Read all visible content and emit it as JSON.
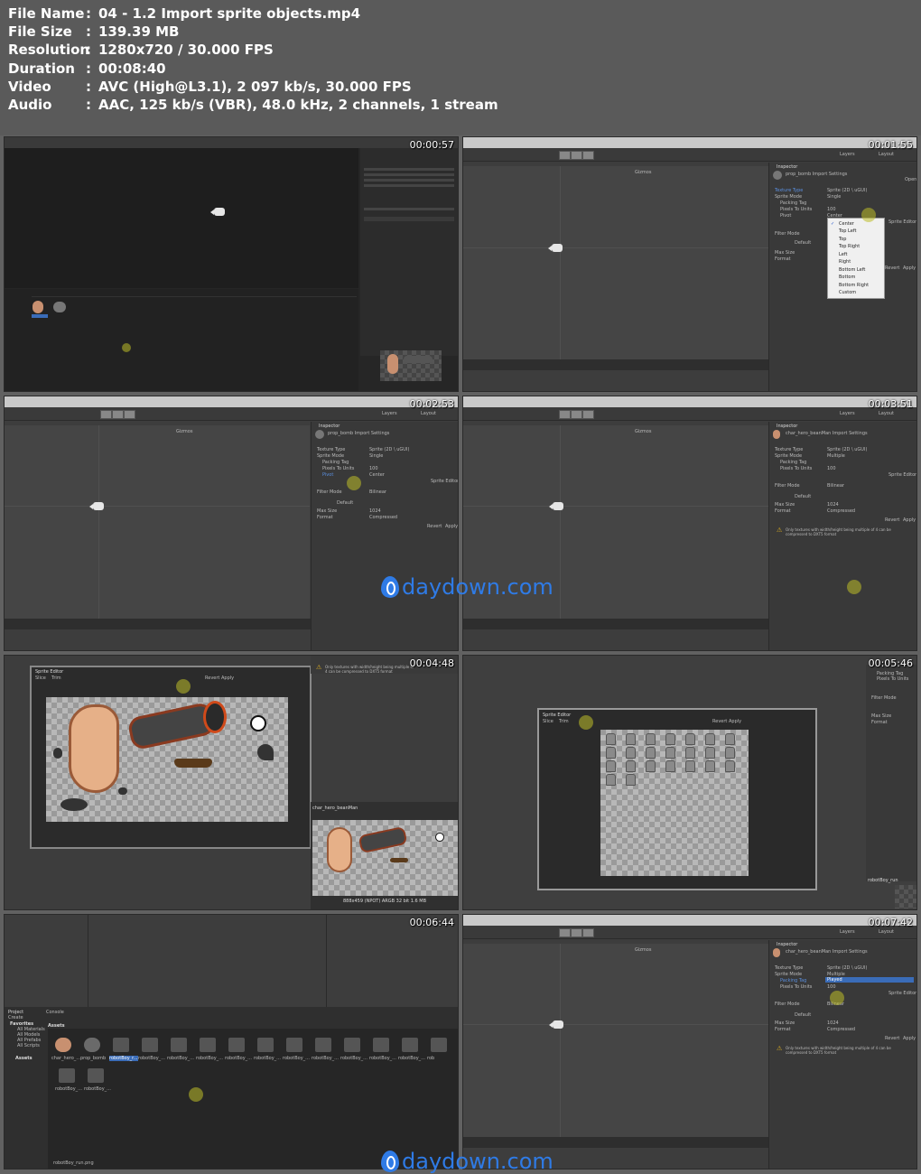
{
  "file_info": [
    {
      "key": "File Name",
      "value": "04 - 1.2 Import sprite objects.mp4"
    },
    {
      "key": "File Size",
      "value": "139.39 MB"
    },
    {
      "key": "Resolution",
      "value": "1280x720 / 30.000 FPS"
    },
    {
      "key": "Duration",
      "value": "00:08:40"
    },
    {
      "key": "Video",
      "value": "AVC (High@L3.1), 2 097 kb/s, 30.000 FPS"
    },
    {
      "key": "Audio",
      "value": "AAC, 125 kb/s (VBR), 48.0 kHz, 2 channels, 1 stream"
    }
  ],
  "separator": ":",
  "thumbnails": [
    {
      "timestamp": "00:00:57"
    },
    {
      "timestamp": "00:01:55"
    },
    {
      "timestamp": "00:02:53"
    },
    {
      "timestamp": "00:03:51"
    },
    {
      "timestamp": "00:04:48"
    },
    {
      "timestamp": "00:05:46"
    },
    {
      "timestamp": "00:06:44"
    },
    {
      "timestamp": "00:07:42"
    }
  ],
  "inspector": {
    "header": "Inspector",
    "prop_bomb_title": "prop_bomb Import Settings",
    "bean_title": "char_hero_beanMan Import Settings",
    "open": "Open",
    "texture_type": "Texture Type",
    "texture_type_value": "Sprite (2D \\ uGUI)",
    "sprite_mode": "Sprite Mode",
    "single": "Single",
    "multiple": "Multiple",
    "packing_tag": "Packing Tag",
    "pixels_to_units": "Pixels To Units",
    "ptu_value": "100",
    "pivot": "Pivot",
    "pivot_value": "Center",
    "sprite_editor": "Sprite Editor",
    "filter_mode": "Filter Mode",
    "filter_value": "Bilinear",
    "default": "Default",
    "max_size": "Max Size",
    "max_size_value": "1024",
    "format": "Format",
    "format_value": "Compressed",
    "revert": "Revert",
    "apply": "Apply",
    "warning": "Only textures with width/height being multiple of 4 can be compressed to DXT5 format",
    "played": "Played"
  },
  "pivot_options": [
    "Center",
    "Top Left",
    "Top",
    "Top Right",
    "Left",
    "Right",
    "Bottom Left",
    "Bottom",
    "Bottom Right",
    "Custom"
  ],
  "toolbar": {
    "layers": "Layers",
    "layout": "Layout",
    "gizmos": "Gizmos"
  },
  "sprite_editor": {
    "title": "Sprite Editor",
    "slice": "Slice",
    "trim": "Trim",
    "revert": "Revert",
    "apply": "Apply"
  },
  "preview": {
    "asset_name": "char_hero_beanMan",
    "asset_name2": "robotBoy_run",
    "info": "888x459 (NPOT)  ARGB 32 bit  1.6 MB"
  },
  "project": {
    "tab_project": "Project",
    "tab_console": "Console",
    "create": "Create",
    "favorites": "Favorites",
    "all_materials": "All Materials",
    "all_models": "All Models",
    "all_prefabs": "All Prefabs",
    "all_scripts": "All Scripts",
    "assets": "Assets",
    "asset_names": [
      "char_hero_...",
      "prop_bomb",
      "robotBoy_r...",
      "robotBoy_...",
      "robotBoy_...",
      "robotBoy_...",
      "robotBoy_...",
      "robotBoy_...",
      "robotBoy_...",
      "robotBoy_...",
      "robotBoy_...",
      "robotBoy_...",
      "robotBoy_...",
      "rob"
    ],
    "asset_names_row2": [
      "robotBoy_...",
      "robotBoy_..."
    ],
    "footer": "robotBoy_run.png"
  },
  "watermark": "daydown.com",
  "colors": {
    "background": "#616161",
    "text": "#ffffff",
    "watermark": "#2f7be6",
    "editor_bg": "#3d3d3d",
    "selection": "#3a6cb8"
  }
}
